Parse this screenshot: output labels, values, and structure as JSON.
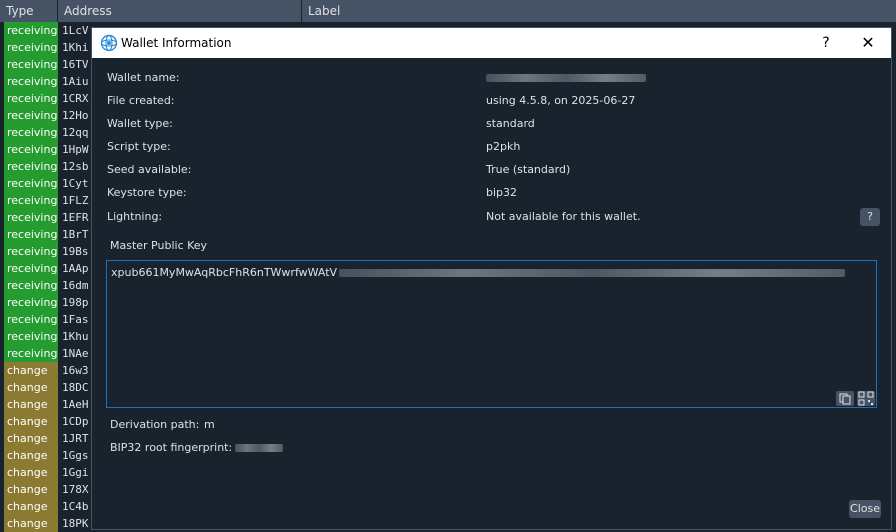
{
  "table": {
    "headers": {
      "type": "Type",
      "address": "Address",
      "label": "Label"
    },
    "rows": [
      {
        "type": "receiving",
        "address": "1LcV"
      },
      {
        "type": "receiving",
        "address": "1Khi"
      },
      {
        "type": "receiving",
        "address": "16TV"
      },
      {
        "type": "receiving",
        "address": "1Aiu"
      },
      {
        "type": "receiving",
        "address": "1CRX"
      },
      {
        "type": "receiving",
        "address": "12Ho"
      },
      {
        "type": "receiving",
        "address": "12qq"
      },
      {
        "type": "receiving",
        "address": "1HpW"
      },
      {
        "type": "receiving",
        "address": "12sb"
      },
      {
        "type": "receiving",
        "address": "1Cyt"
      },
      {
        "type": "receiving",
        "address": "1FLZ"
      },
      {
        "type": "receiving",
        "address": "1EFR"
      },
      {
        "type": "receiving",
        "address": "1BrT"
      },
      {
        "type": "receiving",
        "address": "19Bs"
      },
      {
        "type": "receiving",
        "address": "1AAp"
      },
      {
        "type": "receiving",
        "address": "16dm"
      },
      {
        "type": "receiving",
        "address": "198p"
      },
      {
        "type": "receiving",
        "address": "1Fas"
      },
      {
        "type": "receiving",
        "address": "1Khu"
      },
      {
        "type": "receiving",
        "address": "1NAe"
      },
      {
        "type": "change",
        "address": "16w3"
      },
      {
        "type": "change",
        "address": "18DC"
      },
      {
        "type": "change",
        "address": "1AeH"
      },
      {
        "type": "change",
        "address": "1CDp"
      },
      {
        "type": "change",
        "address": "1JRT"
      },
      {
        "type": "change",
        "address": "1Ggs"
      },
      {
        "type": "change",
        "address": "1Ggi"
      },
      {
        "type": "change",
        "address": "178X"
      },
      {
        "type": "change",
        "address": "1C4b"
      },
      {
        "type": "change",
        "address": "18PK"
      }
    ]
  },
  "dialog": {
    "title": "Wallet Information",
    "help_label": "?",
    "close_glyph": "✕",
    "icon": "electrum-logo-icon",
    "fields": {
      "wallet_name_label": "Wallet name:",
      "file_created_label": "File created:",
      "file_created_value": "using 4.5.8, on 2025-06-27",
      "wallet_type_label": "Wallet type:",
      "wallet_type_value": "standard",
      "script_type_label": "Script type:",
      "script_type_value": "p2pkh",
      "seed_label": "Seed available:",
      "seed_value": "True (standard)",
      "keystore_label": "Keystore type:",
      "keystore_value": "bip32",
      "lightning_label": "Lightning:",
      "lightning_value": "Not available for this wallet.",
      "lightning_help": "?"
    },
    "mpk": {
      "label": "Master Public Key",
      "visible_prefix": "xpub661MyMwAqRbcFhR6nTWwrfwWAtV"
    },
    "derivation_label": "Derivation path:",
    "derivation_value": "m",
    "fingerprint_label": "BIP32 root fingerprint:",
    "close_button": "Close"
  },
  "colors": {
    "receiving": "#249c2f",
    "change": "#8a7a32",
    "accent_border": "#1a72bb",
    "background": "#19232d",
    "header": "#455364"
  }
}
